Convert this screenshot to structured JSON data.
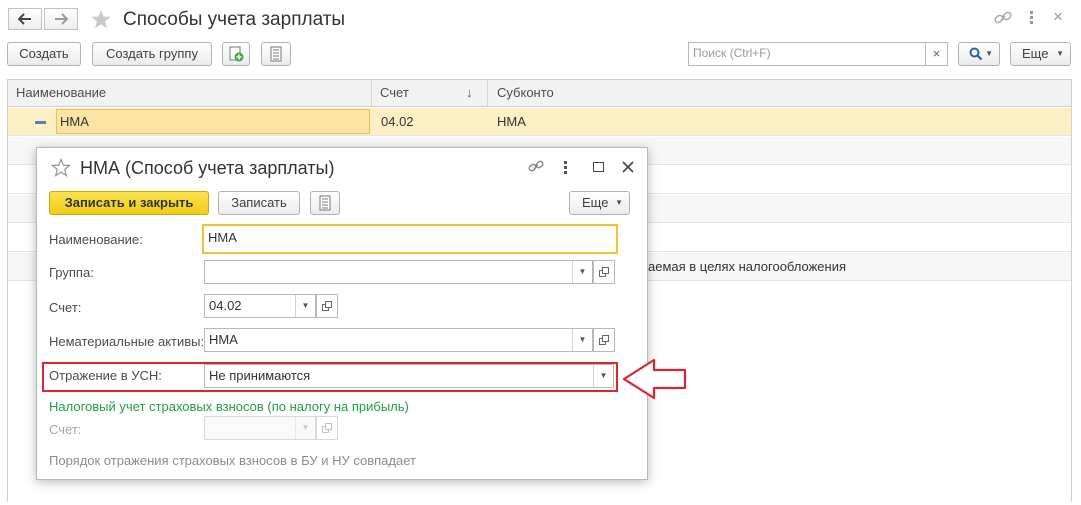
{
  "window": {
    "title": "Способы учета зарплаты",
    "star_icon": "star-icon",
    "link_icon": "link-icon",
    "more_icon": "vertical-dots-icon",
    "close_symbol": "×"
  },
  "toolbar": {
    "create_label": "Создать",
    "create_group_label": "Создать группу",
    "search_placeholder": "Поиск (Ctrl+F)",
    "search_clear": "×",
    "search_icon": "magnifier-icon",
    "more_label": "Еще"
  },
  "table": {
    "columns": [
      "Наименование",
      "Счет",
      "Субконто"
    ],
    "sort_indicator": "↓",
    "rows": [
      {
        "name": "НМА",
        "account": "04.02",
        "subconto": "НМА",
        "selected": true
      }
    ],
    "partial_text": "аемая в целях налогообложения"
  },
  "dialog": {
    "title": "НМА (Способ учета зарплаты)",
    "save_close_label": "Записать и закрыть",
    "save_label": "Записать",
    "more_label": "Еще",
    "fields": {
      "name_label": "Наименование:",
      "name_value": "НМА",
      "group_label": "Группа:",
      "group_value": "",
      "account_label": "Счет:",
      "account_value": "04.02",
      "intangibles_label": "Нематериальные активы:",
      "intangibles_value": "НМА",
      "usn_label": "Отражение в УСН:",
      "usn_value": "Не принимаются"
    },
    "insurance_link": "Налоговый учет страховых взносов (по налогу на прибыль)",
    "insurance_account_label": "Счет:",
    "insurance_account_value": "",
    "footer_note": "Порядок отражения страховых взносов в БУ и НУ совпадает"
  },
  "colors": {
    "accent_yellow": "#f5d73a",
    "selected_row": "#fcefc4",
    "highlight_red": "#e0242f",
    "link_green": "#20a040"
  }
}
